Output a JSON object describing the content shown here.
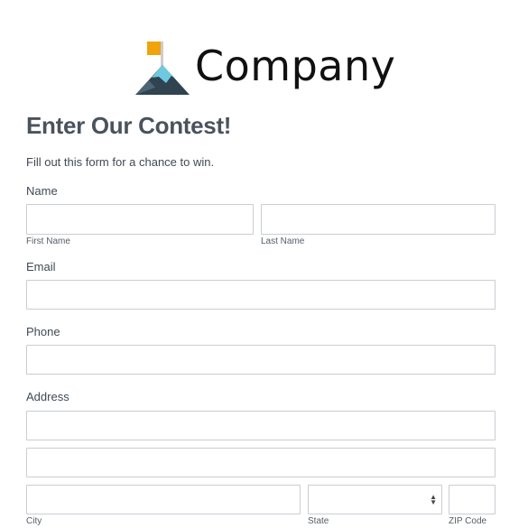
{
  "brand": {
    "name": "Company"
  },
  "form": {
    "title": "Enter Our Contest!",
    "description": "Fill out this form for a chance to win.",
    "name": {
      "label": "Name",
      "first_sublabel": "First Name",
      "last_sublabel": "Last Name",
      "first_value": "",
      "last_value": ""
    },
    "email": {
      "label": "Email",
      "value": ""
    },
    "phone": {
      "label": "Phone",
      "value": ""
    },
    "address": {
      "label": "Address",
      "line1_value": "",
      "line2_value": "",
      "city_sublabel": "City",
      "state_sublabel": "State",
      "zip_sublabel": "ZIP Code",
      "city_value": "",
      "state_value": "",
      "zip_value": ""
    }
  },
  "colors": {
    "flag": "#f0a30a",
    "pole": "#cccccc",
    "mountain_dark": "#2f4351",
    "mountain_light": "#6ec9e0",
    "text": "#3f4a55",
    "border": "#c9cdd2"
  },
  "icons": {
    "logo": "mountain-flag-icon",
    "select": "up-down-chevron-icon"
  }
}
